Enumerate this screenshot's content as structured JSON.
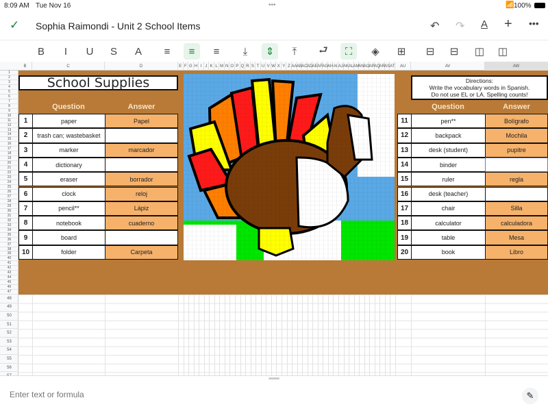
{
  "status": {
    "time": "8:09 AM",
    "date": "Tue Nov 16",
    "battery": "100%",
    "dots": "•••"
  },
  "header": {
    "doc_title": "Sophia Raimondi - Unit 2 School Items",
    "icons": [
      "check-icon",
      "undo-icon",
      "redo-icon",
      "text-format-icon",
      "add-icon",
      "more-icon"
    ]
  },
  "toolbar": {
    "buttons": [
      {
        "name": "bold",
        "glyph": "B",
        "active": false
      },
      {
        "name": "italic",
        "glyph": "I",
        "active": false
      },
      {
        "name": "underline",
        "glyph": "U",
        "active": false
      },
      {
        "name": "strikethrough",
        "glyph": "S",
        "active": false
      },
      {
        "name": "text-color",
        "glyph": "A",
        "active": false
      },
      {
        "name": "align-left",
        "glyph": "≡",
        "active": false
      },
      {
        "name": "align-center",
        "glyph": "≡",
        "active": true
      },
      {
        "name": "align-right",
        "glyph": "≡",
        "active": false
      },
      {
        "name": "valign-bottom",
        "glyph": "⤓",
        "active": false
      },
      {
        "name": "valign-middle",
        "glyph": "⇕",
        "active": true
      },
      {
        "name": "valign-top",
        "glyph": "⤒",
        "active": false
      },
      {
        "name": "wrap",
        "glyph": "⮐",
        "active": false
      },
      {
        "name": "merge",
        "glyph": "⛶",
        "active": true
      },
      {
        "name": "fill-color",
        "glyph": "◈",
        "active": false
      },
      {
        "name": "borders",
        "glyph": "⊞",
        "active": false
      },
      {
        "name": "insert-row-above",
        "glyph": "⊟",
        "active": false
      },
      {
        "name": "insert-row-below",
        "glyph": "⊟",
        "active": false
      },
      {
        "name": "insert-col-left",
        "glyph": "◫",
        "active": false
      },
      {
        "name": "insert-col-right",
        "glyph": "◫",
        "active": false
      }
    ]
  },
  "columns": [
    "B",
    "C",
    "D",
    "E",
    "F",
    "G",
    "H",
    "I",
    "J",
    "K",
    "L",
    "M",
    "N",
    "O",
    "P",
    "Q",
    "R",
    "S",
    "T",
    "U",
    "V",
    "W",
    "X",
    "Y",
    "Z",
    "AA",
    "AB",
    "AC",
    "AD",
    "AE",
    "AF",
    "AG",
    "AH",
    "AI",
    "AJ",
    "AK",
    "AL",
    "AM",
    "AN",
    "AO",
    "AP",
    "AQ",
    "AR",
    "AS",
    "AT",
    "AU",
    "AV",
    "AW"
  ],
  "sheet": {
    "title": "School Supplies",
    "directions": [
      "Directions:",
      "Write the vocabulary words in Spanish.",
      "Do not use EL or LA.  Spelling counts!"
    ],
    "question_header": "Question",
    "answer_header": "Answer",
    "left": [
      {
        "n": "1",
        "q": "paper",
        "a": "Papel"
      },
      {
        "n": "2",
        "q": "trash can; wastebasket",
        "a": ""
      },
      {
        "n": "3",
        "q": "marker",
        "a": "marcador"
      },
      {
        "n": "4",
        "q": "dictionary",
        "a": ""
      },
      {
        "n": "5",
        "q": "eraser",
        "a": "borrador"
      },
      {
        "n": "6",
        "q": "clock",
        "a": "reloj"
      },
      {
        "n": "7",
        "q": "pencil**",
        "a": "Lápiz"
      },
      {
        "n": "8",
        "q": "notebook",
        "a": "cuaderno"
      },
      {
        "n": "9",
        "q": "board",
        "a": ""
      },
      {
        "n": "10",
        "q": "folder",
        "a": "Carpeta"
      }
    ],
    "right": [
      {
        "n": "11",
        "q": "pen**",
        "a": "Bolígrafo"
      },
      {
        "n": "12",
        "q": "backpack",
        "a": "Mochila"
      },
      {
        "n": "13",
        "q": "desk (student)",
        "a": "pupitre"
      },
      {
        "n": "14",
        "q": "binder",
        "a": ""
      },
      {
        "n": "15",
        "q": "ruler",
        "a": "regla"
      },
      {
        "n": "16",
        "q": "desk (teacher)",
        "a": ""
      },
      {
        "n": "17",
        "q": "chair",
        "a": "Silla"
      },
      {
        "n": "18",
        "q": "calculator",
        "a": "calculadora"
      },
      {
        "n": "19",
        "q": "table",
        "a": "Mesa"
      },
      {
        "n": "20",
        "q": "book",
        "a": "Libro"
      }
    ],
    "selected_cell": "AW20"
  },
  "formula_bar": {
    "placeholder": "Enter text or formula",
    "icon": "pencil-icon"
  },
  "colors": {
    "brown": "#b87a36",
    "answer_fill": "#f6b26b",
    "accent_green": "#188038",
    "sky": "#5aa9e6",
    "grass": "#00e600"
  }
}
